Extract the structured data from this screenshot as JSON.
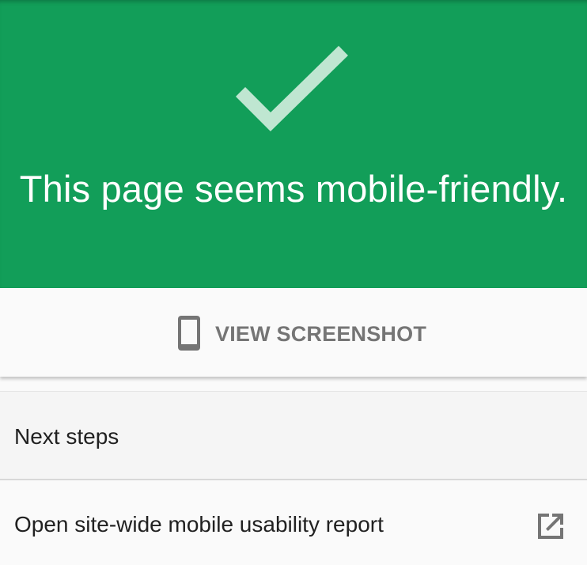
{
  "hero": {
    "status_icon": "check-icon",
    "title": "This page seems mobile-friendly.",
    "background_color": "#129e59"
  },
  "screenshot_action": {
    "icon": "smartphone-icon",
    "label": "VIEW SCREENSHOT"
  },
  "next_steps": {
    "title": "Next steps",
    "items": [
      {
        "label": "Open site-wide mobile usability report",
        "icon": "external-link-icon"
      }
    ]
  }
}
